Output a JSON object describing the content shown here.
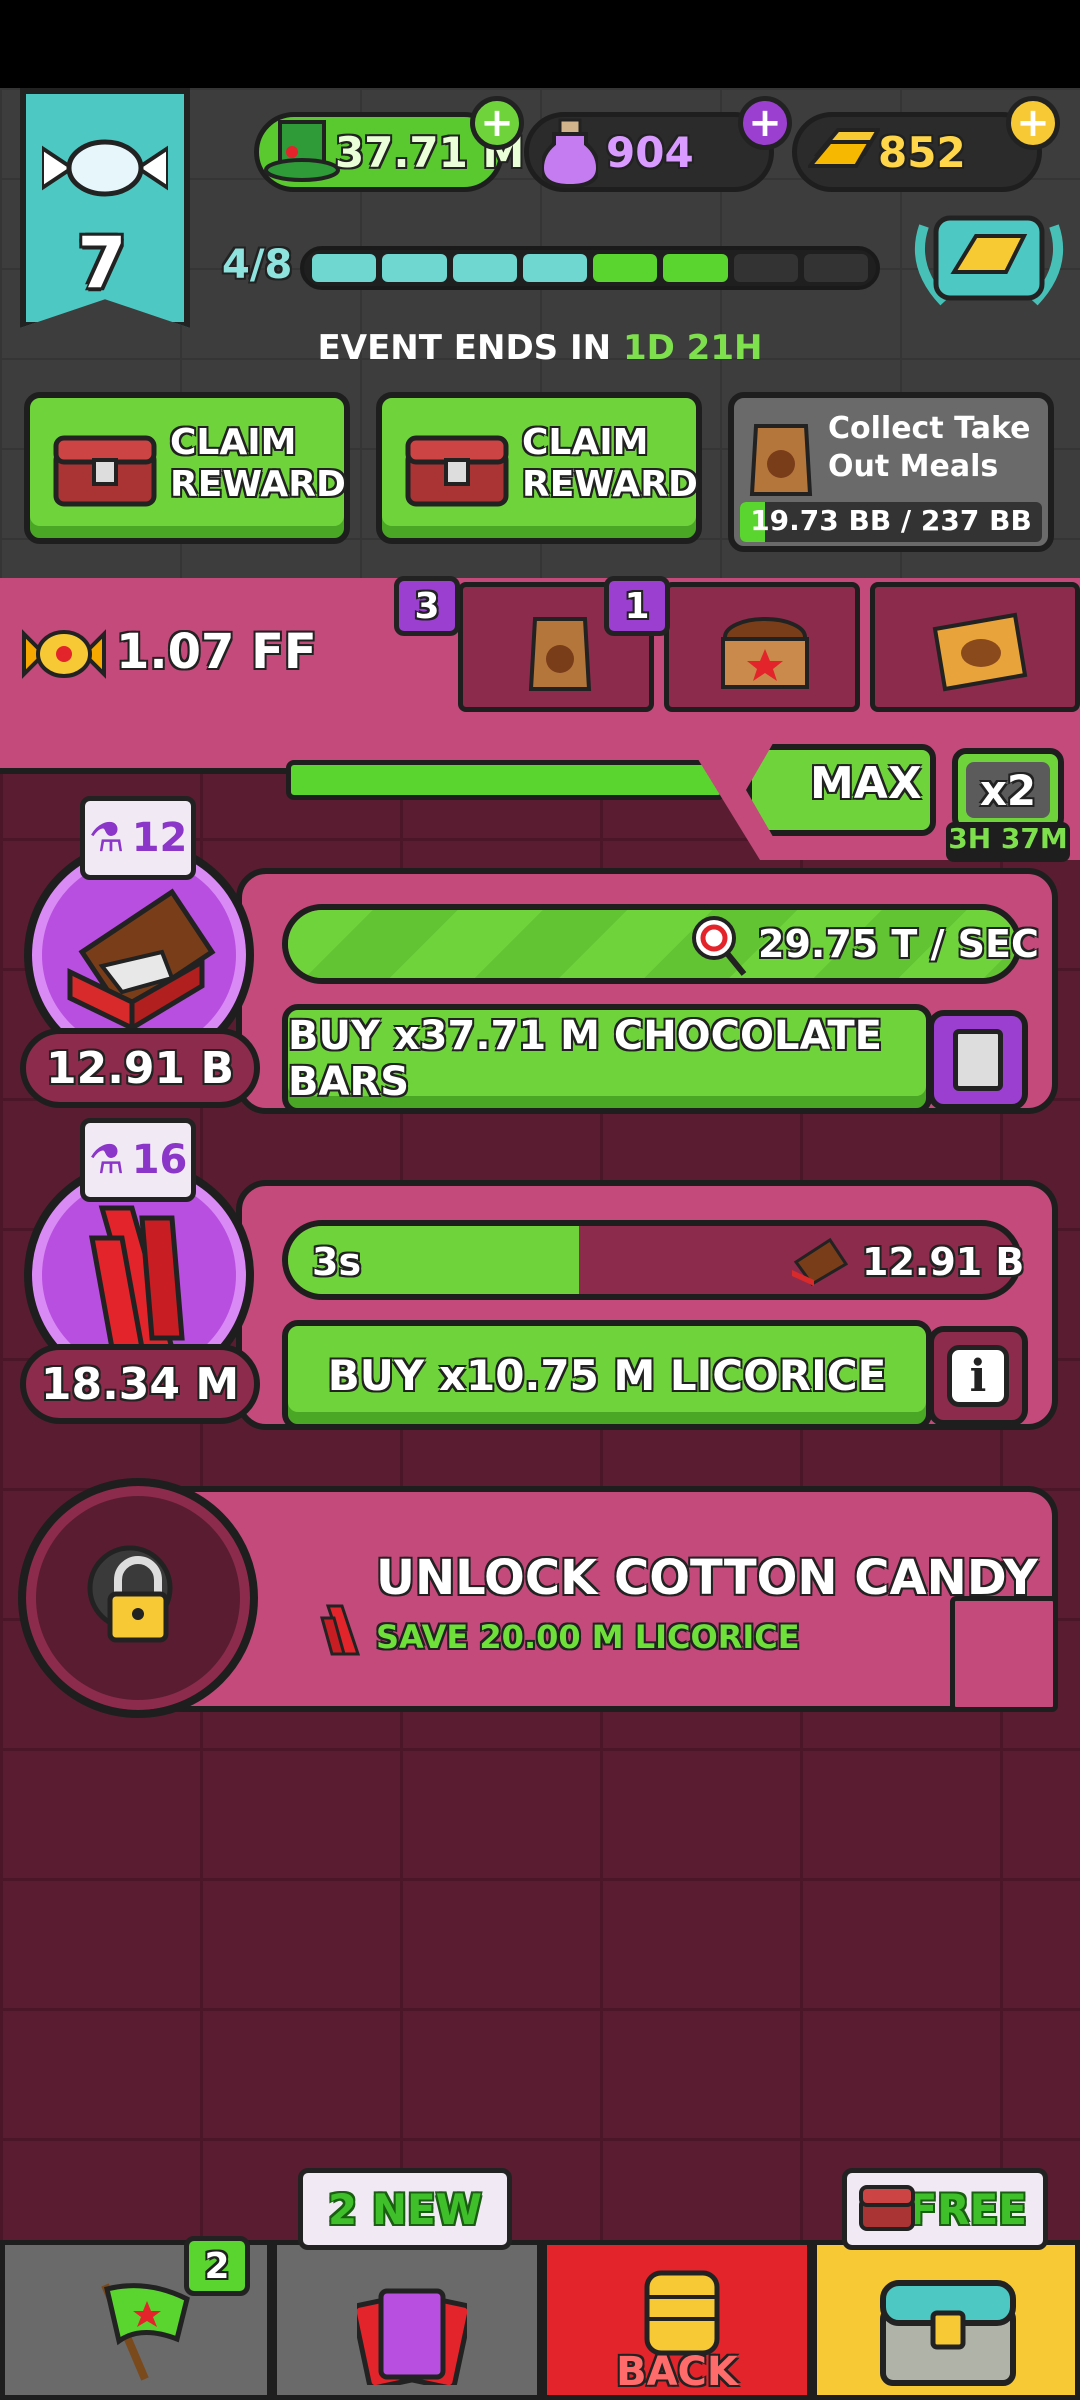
{
  "resources": {
    "hats": "37.71 M",
    "potions": "904",
    "gold": "852"
  },
  "level": {
    "number": "7",
    "progress_text": "4/8"
  },
  "event": {
    "ends_label": "EVENT ENDS IN",
    "time": "1D 21H"
  },
  "claims": [
    {
      "label_line1": "CLAIM",
      "label_line2": "REWARD"
    },
    {
      "label_line1": "CLAIM",
      "label_line2": "REWARD"
    }
  ],
  "collect": {
    "title_line1": "Collect Take",
    "title_line2": "Out Meals",
    "progress": "19.73 BB / 237 BB",
    "progress_fraction": 0.083
  },
  "currency": {
    "candy": "1.07 FF"
  },
  "tabs": {
    "badge1": "3",
    "badge2": "1"
  },
  "multiplier": {
    "max_label": "MAX",
    "boost_label": "x2",
    "boost_timer": "3H 37M"
  },
  "producers": [
    {
      "jar_count": "12",
      "owned": "12.91 B",
      "rate": "29.75 T / SEC",
      "buy_label": "BUY x37.71 M CHOCOLATE BARS"
    },
    {
      "jar_count": "16",
      "owned": "18.34 M",
      "timer": "3s",
      "yield": "12.91 B",
      "buy_label": "BUY x10.75 M LICORICE",
      "info_glyph": "i",
      "progress_fraction": 0.4
    }
  ],
  "locked": {
    "title": "UNLOCK COTTON CANDY",
    "subtitle": "SAVE 20.00 M LICORICE"
  },
  "nav": {
    "flag_badge": "2",
    "cards_tag": "2 NEW",
    "back_label": "BACK",
    "chest_tag": "FREE"
  },
  "colors": {
    "green": "#6fd43c",
    "pink": "#c34a7a",
    "purple": "#b84fe0",
    "teal": "#4ec8c2",
    "red": "#e3242b",
    "yellow": "#f6c935"
  },
  "icons": [
    "candy-icon",
    "top-hat-icon",
    "potion-icon",
    "gold-bar-icon",
    "treasure-chest-icon",
    "takeout-bag-icon",
    "crate-icon",
    "ticket-icon",
    "chocolate-bar-icon",
    "licorice-icon",
    "lollipop-icon",
    "lock-icon",
    "flag-icon",
    "cards-icon",
    "fist-icon"
  ]
}
